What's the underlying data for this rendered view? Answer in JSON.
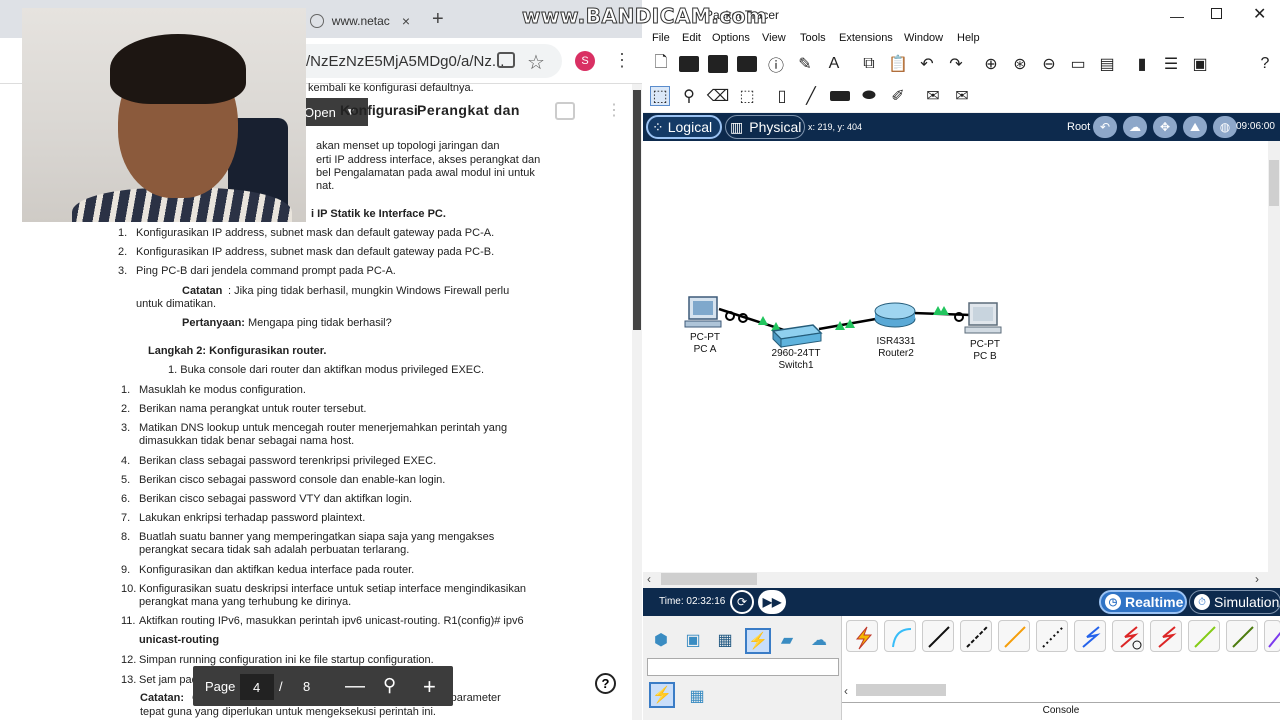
{
  "browser": {
    "tab2_title": "www.netac",
    "new_tab": "+",
    "url": "/NzEzNzE5MjA5MDg0/a/Nz...",
    "avatar_letter": "S",
    "pdf": {
      "open_label": "Open",
      "heading_left": "Konfigurasi",
      "heading_right": "Perangkat   dan",
      "intro_line0": "kembali ke konfigurasi defaultnya.",
      "intro_line1": "akan  menset  up  topologi  jaringan  dan",
      "intro_line2": "erti IP address interface, akses perangkat dan",
      "intro_line3": "bel Pengalamatan pada awal modul ini untuk",
      "intro_line4": "nat.",
      "step1_heading": "i IP Statik ke Interface PC.",
      "step1_items": [
        "Konfigurasikan IP address, subnet mask dan default gateway pada PC-A.",
        "Konfigurasikan IP address, subnet mask dan default gateway pada PC-B.",
        "Ping PC-B dari jendela command prompt pada PC-A."
      ],
      "note_label": "Catatan",
      "note_text": ": Jika ping tidak berhasil, mungkin Windows Firewall perlu",
      "note_text2": "untuk dimatikan.",
      "question_label": "Pertanyaan:",
      "question_text": " Mengapa ping tidak berhasil?",
      "step2_heading": "Langkah 2: Konfigurasikan router.",
      "step2_sub": "1. Buka console dari router dan aktifkan modus privileged EXEC.",
      "step2_items": [
        {
          "n": "1.",
          "t": "Masuklah ke modus configuration."
        },
        {
          "n": "2.",
          "t": "Berikan nama perangkat untuk router tersebut."
        },
        {
          "n": "3.",
          "t": "Matikan DNS lookup untuk mencegah router menerjemahkan perintah yang"
        },
        {
          "n": "",
          "t": "dimasukkan tidak benar sebagai nama host."
        },
        {
          "n": "4.",
          "t": "Berikan class sebagai password terenkripsi privileged EXEC."
        },
        {
          "n": "5.",
          "t": "Berikan cisco sebagai password console dan enable-kan login."
        },
        {
          "n": "6.",
          "t": "Berikan cisco sebagai password VTY dan aktifkan login."
        },
        {
          "n": "7.",
          "t": "Lakukan enkripsi terhadap password plaintext."
        },
        {
          "n": "8.",
          "t": "Buatlah suatu banner yang memperingatkan siapa saja yang mengakses"
        },
        {
          "n": "",
          "t": "perangkat secara tidak sah adalah perbuatan terlarang."
        },
        {
          "n": "9.",
          "t": "Konfigurasikan dan aktifkan kedua interface pada router."
        },
        {
          "n": "10.",
          "t": "Konfigurasikan suatu deskripsi interface untuk setiap interface mengindikasikan"
        },
        {
          "n": "",
          "t": "perangkat mana yang terhubung ke dirinya."
        },
        {
          "n": "11.",
          "t": "Aktifkan routing IPv6, masukkan perintah ipv6 unicast-routing. R1(config)# ipv6"
        },
        {
          "n": "",
          "t": "unicast-routing"
        },
        {
          "n": "12.",
          "t": "Simpan running configuration ini ke file startup configuration."
        },
        {
          "n": "13.",
          "t": "Set jam pada router."
        }
      ],
      "catatan2_label": "Catatan:",
      "catatan2_text": "Gunakan tanda tanya (?) untuk menemukan deretan parameter",
      "catatan2_text2": "tepat guna yang diperlukan untuk mengeksekusi perintah ini.",
      "page_label": "Page",
      "page_current": "4",
      "page_sep": "/",
      "page_total": "8",
      "help": "?"
    }
  },
  "overlay": {
    "recorder_watermark": "www.BANDICAM.com"
  },
  "pt": {
    "title": "Packet Tracer",
    "menu": [
      "File",
      "Edit",
      "Options",
      "View",
      "Tools",
      "Extensions",
      "Window",
      "Help"
    ],
    "tabs": {
      "logical": "Logical",
      "physical": "Physical"
    },
    "coords": "x: 219, y: 404",
    "root": "Root",
    "clock": "09:06:00",
    "devices": [
      {
        "model": "PC-PT",
        "name": "PC A"
      },
      {
        "model": "2960-24TT",
        "name": "Switch1"
      },
      {
        "model": "ISR4331",
        "name": "Router2"
      },
      {
        "model": "PC-PT",
        "name": "PC B"
      }
    ],
    "time_label": "Time: 02:32:16",
    "realtime": "Realtime",
    "simulation": "Simulation",
    "console": "Console"
  }
}
